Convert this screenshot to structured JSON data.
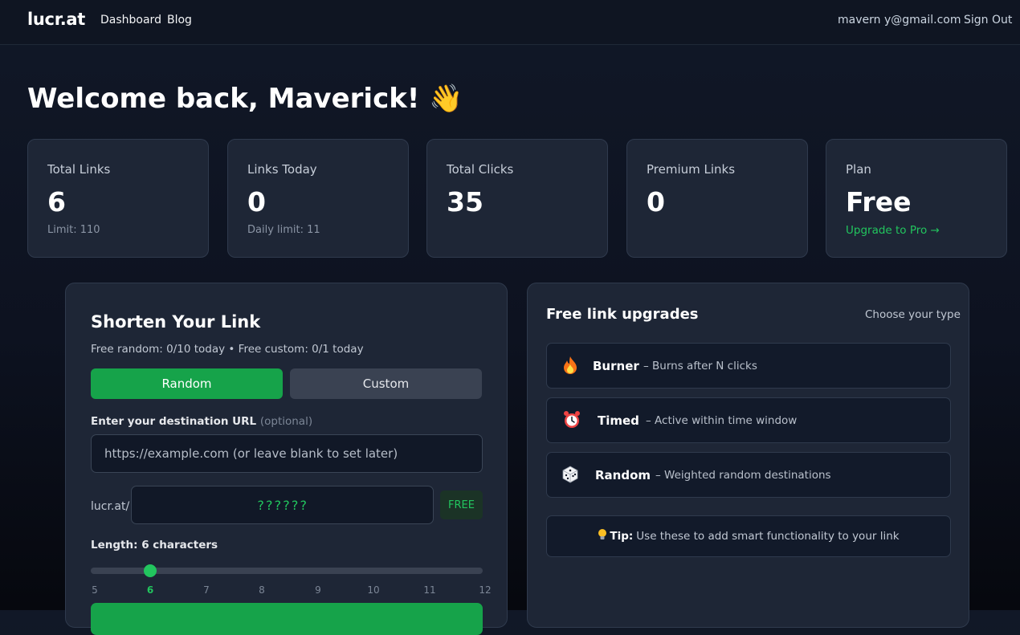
{
  "nav": {
    "brand": "lucr.at",
    "links": [
      "Dashboard",
      "Blog"
    ],
    "user_email": "mavern   y@gmail.com",
    "sign_out": "Sign Out"
  },
  "welcome": "Welcome back, Maverick! 👋",
  "stats": [
    {
      "label": "Total Links",
      "value": "6",
      "sub": "Limit: 110"
    },
    {
      "label": "Links Today",
      "value": "0",
      "sub": "Daily limit: 11"
    },
    {
      "label": "Total Clicks",
      "value": "35"
    },
    {
      "label": "Premium Links",
      "value": "0"
    },
    {
      "label": "Plan",
      "value": "Free",
      "link": "Upgrade to Pro →"
    }
  ],
  "shorten": {
    "title": "Shorten Your Link",
    "quota": "Free random: 0/10 today • Free custom: 0/1 today",
    "tab_random": "Random",
    "tab_custom": "Custom",
    "url_label": "Enter your destination URL",
    "url_optional": "(optional)",
    "url_placeholder": "https://example.com (or leave blank to set later)",
    "prefix": "lucr.at/",
    "slug": "??????",
    "free_badge": "FREE",
    "length_label": "Length: 6 characters",
    "length_value": 6,
    "length_min": 5,
    "length_max": 12,
    "ticks": [
      "5",
      "6",
      "7",
      "8",
      "9",
      "10",
      "11",
      "12"
    ]
  },
  "upgrades": {
    "title": "Free link upgrades",
    "hint": "Choose your type",
    "items": [
      {
        "icon": "fire-icon",
        "name": "Burner",
        "desc": "– Burns after N clicks"
      },
      {
        "icon": "alarm-clock-icon",
        "name": "Timed",
        "desc": "– Active within time window"
      },
      {
        "icon": "dice-icon",
        "name": "Random",
        "desc": "– Weighted random destinations"
      }
    ],
    "tip_label": "Tip:",
    "tip_text": "Use these to add smart functionality to your link"
  },
  "colors": {
    "accent": "#16a34a",
    "accent_text": "#22c55e",
    "card": "#1e2636",
    "background": "#111827"
  }
}
